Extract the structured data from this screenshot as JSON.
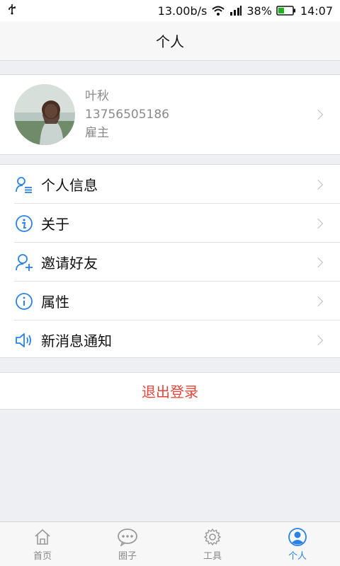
{
  "status_bar": {
    "usb_icon": "usb-icon",
    "net_speed": "13.00b/s",
    "battery_percent": "38%",
    "time": "14:07"
  },
  "header": {
    "title": "个人"
  },
  "profile": {
    "name": "叶秋",
    "phone": "13756505186",
    "role": "雇主"
  },
  "menu": {
    "items": [
      {
        "label": "个人信息",
        "icon": "user-info-icon"
      },
      {
        "label": "关于",
        "icon": "info-circle-icon"
      },
      {
        "label": "邀请好友",
        "icon": "add-user-icon"
      },
      {
        "label": "属性",
        "icon": "info-circle-icon"
      },
      {
        "label": "新消息通知",
        "icon": "speaker-icon"
      }
    ]
  },
  "logout": {
    "label": "退出登录"
  },
  "tabbar": {
    "tabs": [
      {
        "label": "首页",
        "icon": "home-icon",
        "active": false
      },
      {
        "label": "圈子",
        "icon": "chat-bubble-icon",
        "active": false
      },
      {
        "label": "工具",
        "icon": "gear-icon",
        "active": false
      },
      {
        "label": "个人",
        "icon": "person-icon",
        "active": true
      }
    ]
  },
  "colors": {
    "accent": "#2a82e4",
    "logout": "#e2453a",
    "battery": "#1fb31f"
  }
}
